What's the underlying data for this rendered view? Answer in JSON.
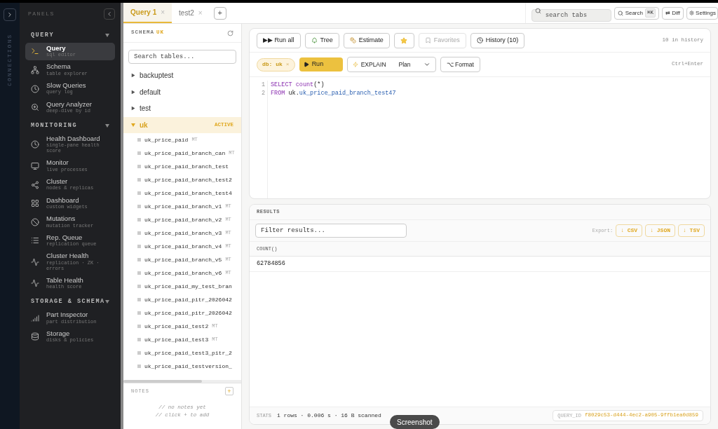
{
  "rail": {
    "label": "CONNECTIONS"
  },
  "sidebar": {
    "title": "PANELS",
    "sections": [
      {
        "title": "QUERY",
        "expanded": true,
        "items": [
          {
            "label": "Query",
            "sub": "sql editor",
            "selected": true
          },
          {
            "label": "Schema",
            "sub": "table explorer",
            "selected": false
          },
          {
            "label": "Slow Queries",
            "sub": "query log",
            "selected": false
          },
          {
            "label": "Query Analyzer",
            "sub": "deep-dive by id",
            "selected": false
          }
        ]
      },
      {
        "title": "MONITORING",
        "expanded": true,
        "items": [
          {
            "label": "Health Dashboard",
            "sub": "single-pane health score",
            "selected": false
          },
          {
            "label": "Monitor",
            "sub": "live processes",
            "selected": false
          },
          {
            "label": "Cluster",
            "sub": "nodes & replicas",
            "selected": false
          },
          {
            "label": "Dashboard",
            "sub": "custom widgets",
            "selected": false
          },
          {
            "label": "Mutations",
            "sub": "mutation tracker",
            "selected": false
          },
          {
            "label": "Rep. Queue",
            "sub": "replication queue",
            "selected": false
          },
          {
            "label": "Cluster Health",
            "sub": "replication · ZK · errors",
            "selected": false
          },
          {
            "label": "Table Health",
            "sub": "health score",
            "selected": false
          }
        ]
      },
      {
        "title": "STORAGE & SCHEMA",
        "expanded": true,
        "items": [
          {
            "label": "Part Inspector",
            "sub": "part distribution",
            "selected": false
          },
          {
            "label": "Storage",
            "sub": "disks & policies",
            "selected": false
          }
        ]
      }
    ]
  },
  "tabs": [
    {
      "label": "Query 1",
      "close": "×",
      "selected": true
    },
    {
      "label": "test2",
      "close": "×",
      "selected": false
    }
  ],
  "new_tab": "+",
  "toolbar": {
    "search_placeholder": "search tabs",
    "search": "Search",
    "shortcut": "⌘K",
    "diff": "⇄ Diff",
    "settings": "Settings"
  },
  "schema": {
    "label": "SCHEMA",
    "db": "UK",
    "search_placeholder": "Search tables...",
    "databases": [
      {
        "name": "backuptest",
        "expanded": false,
        "selected": false
      },
      {
        "name": "default",
        "expanded": false,
        "selected": false
      },
      {
        "name": "test",
        "expanded": false,
        "selected": false
      },
      {
        "name": "uk",
        "expanded": true,
        "selected": true,
        "badge": "ACTIVE",
        "children": [
          {
            "name": "uk_price_paid",
            "engine": "MT"
          },
          {
            "name": "uk_price_paid_branch_can",
            "engine": "MT"
          },
          {
            "name": "uk_price_paid_branch_test"
          },
          {
            "name": "uk_price_paid_branch_test2"
          },
          {
            "name": "uk_price_paid_branch_test4"
          },
          {
            "name": "uk_price_paid_branch_v1",
            "engine": "MT"
          },
          {
            "name": "uk_price_paid_branch_v2",
            "engine": "MT"
          },
          {
            "name": "uk_price_paid_branch_v3",
            "engine": "MT"
          },
          {
            "name": "uk_price_paid_branch_v4",
            "engine": "MT"
          },
          {
            "name": "uk_price_paid_branch_v5",
            "engine": "MT"
          },
          {
            "name": "uk_price_paid_branch_v6",
            "engine": "MT"
          },
          {
            "name": "uk_price_paid_my_test_bran"
          },
          {
            "name": "uk_price_paid_pitr_2026042"
          },
          {
            "name": "uk_price_paid_pitr_2026042"
          },
          {
            "name": "uk_price_paid_test2",
            "engine": "MT"
          },
          {
            "name": "uk_price_paid_test3",
            "engine": "MT"
          },
          {
            "name": "uk_price_paid_test3_pitr_2"
          },
          {
            "name": "uk_price_paid_testversion_"
          }
        ]
      }
    ]
  },
  "notes": {
    "title": "NOTES",
    "add": "+",
    "empty": [
      "// no notes yet",
      "// click + to add"
    ]
  },
  "editor": {
    "actions": [
      "▶▶ Run all",
      "Tree",
      "Estimate",
      "Favorites",
      "History (10)"
    ],
    "favorites_disabled": true,
    "history_count": "10 in history",
    "db_chip": "db: uk",
    "db_close": "×",
    "run": "Run",
    "explain": "EXPLAIN",
    "explain_mode": "Plan",
    "format": "⌥ Format",
    "hint": "Ctrl+Enter",
    "lines": [
      {
        "number": "1",
        "tokens": [
          {
            "kind": "keyword",
            "text": "SELECT count"
          },
          {
            "kind": "plain",
            "text": "(*)"
          }
        ]
      },
      {
        "number": "2",
        "tokens": [
          {
            "kind": "keyword",
            "text": "FROM"
          },
          {
            "kind": "plain",
            "text": " uk."
          },
          {
            "kind": "identifier",
            "text": "uk_price_paid_branch_test47"
          }
        ]
      }
    ]
  },
  "results": {
    "title": "RESULTS",
    "filter_placeholder": "Filter results...",
    "export_label": "Export:",
    "exports": [
      "↓ CSV",
      "↓ JSON",
      "↓ TSV"
    ],
    "columns": [
      "COUNT()"
    ],
    "rows": [
      [
        "62784856"
      ]
    ],
    "stats_label": "STATS",
    "stats": "1 rows · 0.006 s · 16 B scanned",
    "query_id_label": "QUERY_ID",
    "query_id": "f8029c53-d444-4ec2-a905-9ffb1ea0d859"
  },
  "tooltip": "Screenshot"
}
